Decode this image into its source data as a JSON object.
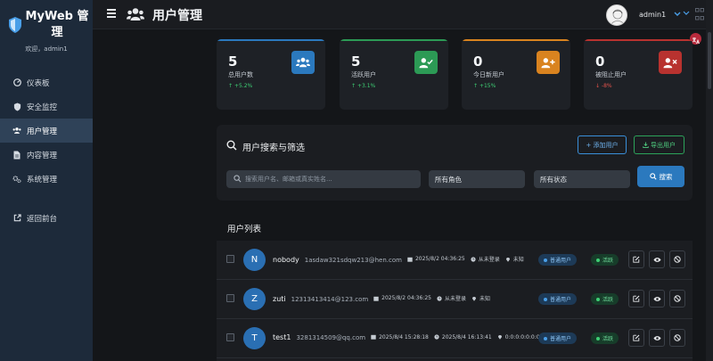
{
  "sidebar": {
    "brand": "MyWeb 管理",
    "welcome": "欢迎，admin1",
    "items": [
      {
        "label": "仪表板",
        "icon": "dashboard-icon"
      },
      {
        "label": "安全监控",
        "icon": "shield-icon"
      },
      {
        "label": "用户管理",
        "icon": "users-icon",
        "active": true
      },
      {
        "label": "内容管理",
        "icon": "file-icon"
      },
      {
        "label": "系统管理",
        "icon": "gears-icon"
      }
    ],
    "back": {
      "label": "返回前台",
      "icon": "external-link-icon"
    }
  },
  "header": {
    "title": "用户管理",
    "username": "admin1"
  },
  "stats": [
    {
      "value": "5",
      "label": "总用户数",
      "trend": "+5.2%",
      "direction": "up",
      "color": "#2b79be",
      "icon": "users-icon"
    },
    {
      "value": "5",
      "label": "活跃用户",
      "trend": "+3.1%",
      "direction": "up",
      "color": "#2c9a55",
      "icon": "user-check-icon"
    },
    {
      "value": "0",
      "label": "今日新用户",
      "trend": "+15%",
      "direction": "up",
      "color": "#d9831f",
      "icon": "user-plus-icon"
    },
    {
      "value": "0",
      "label": "被阻止用户",
      "trend": "-8%",
      "direction": "down",
      "color": "#b8322f",
      "icon": "user-block-icon"
    }
  ],
  "search_panel": {
    "title": "用户搜索与筛选",
    "add_label": "添加用户",
    "export_label": "导出用户",
    "search_placeholder": "搜索用户名、邮箱或真实姓名...",
    "role_select": "所有角色",
    "status_select": "所有状态",
    "search_button": "搜索"
  },
  "user_list": {
    "title": "用户列表",
    "rows": [
      {
        "initial": "N",
        "name": "nobody",
        "email": "1asdaw321sdqw213@hen.com",
        "created": "2025/8/2 04:36:25",
        "last_login": "从未登录",
        "ip": "未知",
        "role": "普通用户",
        "status": "活跃"
      },
      {
        "initial": "Z",
        "name": "zuti",
        "email": "12313413414@123.com",
        "created": "2025/8/2 04:36:25",
        "last_login": "从未登录",
        "ip": "未知",
        "role": "普通用户",
        "status": "活跃"
      },
      {
        "initial": "T",
        "name": "test1",
        "email": "3281314509@qq.com",
        "created": "2025/8/4 15:28:18",
        "last_login": "2025/8/4 16:13:41",
        "ip": "0:0:0:0:0:0:0:1",
        "role": "普通用户",
        "status": "活跃"
      }
    ]
  },
  "colors": {
    "accent": "#2b79be",
    "success": "#2c9a55",
    "warning": "#d9831f",
    "danger": "#b8322f",
    "up": "#3ecf74",
    "down": "#e5534b"
  }
}
